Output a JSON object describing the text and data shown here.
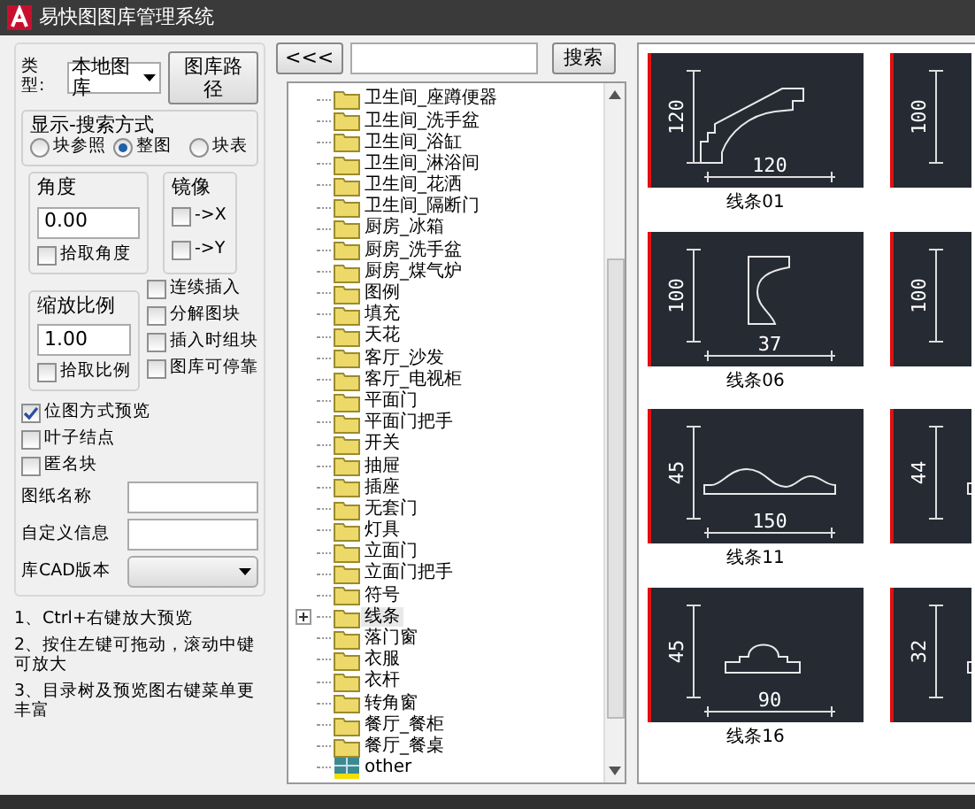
{
  "window": {
    "title": "易快图图库管理系统"
  },
  "type_row": {
    "label": "类型:",
    "library": "本地图库",
    "path_button": "图库路径"
  },
  "display_mode": {
    "title": "显示-搜索方式",
    "options": [
      {
        "label": "块参照",
        "selected": false
      },
      {
        "label": "整图",
        "selected": true
      },
      {
        "label": "块表",
        "selected": false
      }
    ]
  },
  "angle": {
    "title": "角度",
    "value": "0.00",
    "pick": {
      "label": "拾取角度",
      "checked": false
    }
  },
  "mirror": {
    "title": "镜像",
    "options": [
      {
        "label": "->X",
        "checked": false
      },
      {
        "label": "->Y",
        "checked": false
      }
    ]
  },
  "scale": {
    "title": "缩放比例",
    "value": "1.00",
    "pick": {
      "label": "拾取比例",
      "checked": false
    }
  },
  "insert_options": [
    {
      "label": "连续插入",
      "checked": false
    },
    {
      "label": "分解图块",
      "checked": false
    },
    {
      "label": "插入时组块",
      "checked": false
    },
    {
      "label": "图库可停靠",
      "checked": false
    }
  ],
  "preview_options": [
    {
      "label": "位图方式预览",
      "checked": true
    },
    {
      "label": "叶子结点",
      "checked": false
    },
    {
      "label": "匿名块",
      "checked": false
    }
  ],
  "fields": [
    {
      "label": "图纸名称",
      "kind": "text"
    },
    {
      "label": "自定义信息",
      "kind": "text"
    },
    {
      "label": "库CAD版本",
      "kind": "select"
    }
  ],
  "notes": [
    "1、Ctrl+右键放大预览",
    "2、按住左键可拖动，滚动中键可放大",
    "3、目录树及预览图右键菜单更丰富"
  ],
  "toolbar": {
    "back_button": "<<<",
    "search_button": "搜索"
  },
  "tree": [
    {
      "label": "卫生间_座蹲便器",
      "kind": "folder",
      "selected": false
    },
    {
      "label": "卫生间_洗手盆",
      "kind": "folder",
      "selected": false
    },
    {
      "label": "卫生间_浴缸",
      "kind": "folder",
      "selected": false
    },
    {
      "label": "卫生间_淋浴间",
      "kind": "folder",
      "selected": false
    },
    {
      "label": "卫生间_花洒",
      "kind": "folder",
      "selected": false
    },
    {
      "label": "卫生间_隔断门",
      "kind": "folder",
      "selected": false
    },
    {
      "label": "厨房_冰箱",
      "kind": "folder",
      "selected": false
    },
    {
      "label": "厨房_洗手盆",
      "kind": "folder",
      "selected": false
    },
    {
      "label": "厨房_煤气炉",
      "kind": "folder",
      "selected": false
    },
    {
      "label": "图例",
      "kind": "folder",
      "selected": false
    },
    {
      "label": "填充",
      "kind": "folder",
      "selected": false
    },
    {
      "label": "天花",
      "kind": "folder",
      "selected": false
    },
    {
      "label": "客厅_沙发",
      "kind": "folder",
      "selected": false
    },
    {
      "label": "客厅_电视柜",
      "kind": "folder",
      "selected": false
    },
    {
      "label": "平面门",
      "kind": "folder",
      "selected": false
    },
    {
      "label": "平面门把手",
      "kind": "folder",
      "selected": false
    },
    {
      "label": "开关",
      "kind": "folder",
      "selected": false
    },
    {
      "label": "抽屉",
      "kind": "folder",
      "selected": false
    },
    {
      "label": "插座",
      "kind": "folder",
      "selected": false
    },
    {
      "label": "无套门",
      "kind": "folder",
      "selected": false
    },
    {
      "label": "灯具",
      "kind": "folder",
      "selected": false
    },
    {
      "label": "立面门",
      "kind": "folder",
      "selected": false
    },
    {
      "label": "立面门把手",
      "kind": "folder",
      "selected": false
    },
    {
      "label": "符号",
      "kind": "folder",
      "selected": false
    },
    {
      "label": "线条",
      "kind": "group",
      "expanded": false,
      "selected": true
    },
    {
      "label": "落门窗",
      "kind": "folder",
      "selected": false
    },
    {
      "label": "衣服",
      "kind": "folder",
      "selected": false
    },
    {
      "label": "衣杆",
      "kind": "folder",
      "selected": false
    },
    {
      "label": "转角窗",
      "kind": "folder",
      "selected": false
    },
    {
      "label": "餐厅_餐柜",
      "kind": "folder",
      "selected": false
    },
    {
      "label": "餐厅_餐桌",
      "kind": "folder",
      "selected": false
    },
    {
      "label": "other",
      "kind": "library",
      "selected": false
    }
  ],
  "previews": [
    [
      {
        "label": "线条01",
        "kind": "crown",
        "dims": [
          "120",
          "120"
        ]
      },
      {
        "kind": "cove",
        "dims": [
          "100"
        ]
      }
    ],
    [
      {
        "label": "线条06",
        "kind": "cove",
        "dims": [
          "100",
          "37"
        ]
      },
      {
        "kind": "cove",
        "dims": [
          "100"
        ]
      }
    ],
    [
      {
        "label": "线条11",
        "kind": "wave",
        "dims": [
          "45",
          "150"
        ]
      },
      {
        "kind": "dome",
        "dims": [
          "44"
        ]
      }
    ],
    [
      {
        "label": "线条16",
        "kind": "dome",
        "dims": [
          "45",
          "90"
        ]
      },
      {
        "kind": "dome",
        "dims": [
          "32"
        ]
      }
    ]
  ]
}
